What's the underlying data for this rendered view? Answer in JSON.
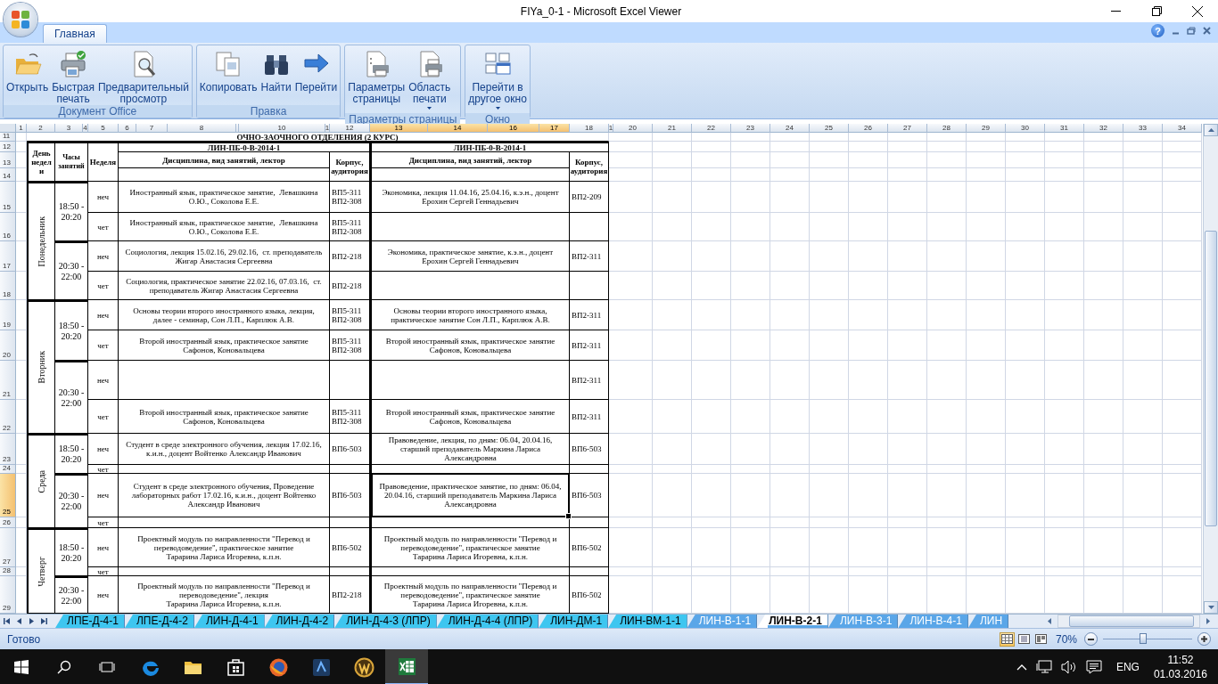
{
  "window": {
    "title": "FIYa_0-1 - Microsoft Excel Viewer"
  },
  "ribbon_tabs": [
    {
      "label": "Главная",
      "selected": true
    }
  ],
  "help": "?",
  "ribbon_groups": [
    {
      "label": "Документ Office",
      "buttons": [
        {
          "label": "Открыть",
          "kind": "open",
          "dropdown": false
        },
        {
          "label": "Быстрая\nпечать",
          "kind": "quick_print",
          "dropdown": false
        },
        {
          "label": "Предварительный\nпросмотр",
          "kind": "preview",
          "dropdown": false
        }
      ]
    },
    {
      "label": "Правка",
      "buttons": [
        {
          "label": "Копировать",
          "kind": "copy",
          "dropdown": false
        },
        {
          "label": "Найти",
          "kind": "find",
          "dropdown": false
        },
        {
          "label": "Перейти",
          "kind": "goto",
          "dropdown": false
        }
      ]
    },
    {
      "label": "Параметры страницы",
      "buttons": [
        {
          "label": "Параметры\nстраницы",
          "kind": "page_setup",
          "dropdown": false
        },
        {
          "label": "Область\nпечати",
          "kind": "print_area",
          "dropdown": true
        }
      ]
    },
    {
      "label": "Окно",
      "buttons": [
        {
          "label": "Перейти в\nдругое окно",
          "kind": "switch_window",
          "dropdown": true
        }
      ]
    }
  ],
  "sheet": {
    "column_headers": [
      {
        "label": "1",
        "selected": false
      },
      {
        "label": "2",
        "selected": false
      },
      {
        "label": "3",
        "selected": false
      },
      {
        "label": "4",
        "selected": false
      },
      {
        "label": "5",
        "selected": false
      },
      {
        "label": "6",
        "selected": false
      },
      {
        "label": "7",
        "selected": false
      },
      {
        "label": "8",
        "selected": false
      },
      {
        "label": "10",
        "selected": false
      },
      {
        "label": "1",
        "selected": false
      },
      {
        "label": "12",
        "selected": false
      },
      {
        "label": "13",
        "selected": true
      },
      {
        "label": "14",
        "selected": true
      },
      {
        "label": "16",
        "selected": true
      },
      {
        "label": "17",
        "selected": true
      },
      {
        "label": "18",
        "selected": false
      },
      {
        "label": "1",
        "selected": false
      },
      {
        "label": "20",
        "selected": false
      },
      {
        "label": "21",
        "selected": false
      },
      {
        "label": "22",
        "selected": false
      },
      {
        "label": "23",
        "selected": false
      },
      {
        "label": "24",
        "selected": false
      },
      {
        "label": "25",
        "selected": false
      },
      {
        "label": "26",
        "selected": false
      },
      {
        "label": "27",
        "selected": false
      },
      {
        "label": "28",
        "selected": false
      },
      {
        "label": "29",
        "selected": false
      },
      {
        "label": "30",
        "selected": false
      },
      {
        "label": "31",
        "selected": false
      },
      {
        "label": "32",
        "selected": false
      },
      {
        "label": "33",
        "selected": false
      },
      {
        "label": "34",
        "selected": false
      }
    ],
    "row_headers": [
      {
        "label": "11",
        "selected": false
      },
      {
        "label": "12",
        "selected": false
      },
      {
        "label": "13",
        "selected": false
      },
      {
        "label": "14",
        "selected": false
      },
      {
        "label": "15",
        "selected": false
      },
      {
        "label": "16",
        "selected": false
      },
      {
        "label": "17",
        "selected": false
      },
      {
        "label": "18",
        "selected": false
      },
      {
        "label": "19",
        "selected": false
      },
      {
        "label": "20",
        "selected": false
      },
      {
        "label": "21",
        "selected": false
      },
      {
        "label": "22",
        "selected": false
      },
      {
        "label": "23",
        "selected": false
      },
      {
        "label": "24",
        "selected": false
      },
      {
        "label": "25",
        "selected": true
      },
      {
        "label": "26",
        "selected": false
      },
      {
        "label": "27",
        "selected": false
      },
      {
        "label": "28",
        "selected": false
      },
      {
        "label": "29",
        "selected": false
      }
    ],
    "title": "ОЧНО-ЗАОЧНОГО ОТДЕЛЕНИЯ (2 КУРС)",
    "header": {
      "day": "День недели",
      "hours": "Часы занятий",
      "week": "Неделя",
      "groups": [
        {
          "name": "ЛИН-ПБ-0-В-2014-1",
          "discipline": "Дисциплина, вид занятий, лектор",
          "room": "Корпус, аудитория"
        },
        {
          "name": "ЛИН-ПБ-0-В-2014-1",
          "discipline": "Дисциплина, вид занятий, лектор",
          "room": "Корпус, аудитория"
        }
      ]
    },
    "days": [
      {
        "day": "Понедельник",
        "slots": [
          {
            "hours": "18:50 -\n20:20",
            "weeks": [
              {
                "week": "неч",
                "lessons": [
                  {
                    "discipline": "Иностранный язык, практическое занятие,  Левашкина\nО.Ю., Соколова Е.Е.",
                    "room": "ВП5-311\nВП2-308",
                    "selected": false
                  },
                  {
                    "discipline": "Экономика, лекция 11.04.16, 25.04.16, к.э.н., доцент\nЕрохин Сергей Геннадьевич",
                    "room": "ВП2-209",
                    "selected": false
                  }
                ]
              },
              {
                "week": "чет",
                "lessons": [
                  {
                    "discipline": "Иностранный язык, практическое занятие,  Левашкина\nО.Ю., Соколова Е.Е.",
                    "room": "ВП5-311\nВП2-308",
                    "selected": false
                  },
                  {
                    "selected": false
                  }
                ]
              }
            ]
          },
          {
            "hours": "20:30 -\n22:00",
            "weeks": [
              {
                "week": "неч",
                "lessons": [
                  {
                    "discipline": "Социология, лекция 15.02.16, 29.02.16,  ст. преподаватель\nЖигар Анастасия Сергеевна",
                    "room": "ВП2-218",
                    "selected": false
                  },
                  {
                    "discipline": "Экономика, практическое занятие, к.э.н., доцент\nЕрохин Сергей Геннадьевич",
                    "room": "ВП2-311",
                    "selected": false
                  }
                ]
              },
              {
                "week": "чет",
                "lessons": [
                  {
                    "discipline": "Социология, практическое занятие 22.02.16, 07.03.16,  ст.\nпреподаватель Жигар Анастасия Сергеевна",
                    "room": "ВП2-218",
                    "selected": false
                  },
                  {
                    "selected": false
                  }
                ]
              }
            ]
          }
        ]
      },
      {
        "day": "Вторник",
        "slots": [
          {
            "hours": "18:50 -\n20:20",
            "weeks": [
              {
                "week": "неч",
                "lessons": [
                  {
                    "discipline": "Основы теории второго иностранного языка, лекция,\nдалее - семинар, Сон Л.П., Карплюк А.В.",
                    "room": "ВП5-311\nВП2-308",
                    "selected": false
                  },
                  {
                    "discipline": "Основы теории второго иностранного языка,\nпрактическое занятие Сон Л.П., Карплюк А.В.",
                    "room": "ВП2-311",
                    "selected": false
                  }
                ]
              },
              {
                "week": "чет",
                "lessons": [
                  {
                    "discipline": "Второй иностранный язык, практическое занятие\nСафонов, Коновальцева",
                    "room": "ВП5-311\nВП2-308",
                    "selected": false
                  },
                  {
                    "discipline": "Второй иностранный язык, практическое занятие\nСафонов, Коновальцева",
                    "room": "ВП2-311",
                    "selected": false
                  }
                ]
              }
            ]
          },
          {
            "hours": "20:30 -\n22:00",
            "weeks": [
              {
                "week": "неч",
                "lessons": [
                  {
                    "selected": false
                  },
                  {
                    "room": "ВП2-311",
                    "selected": false
                  }
                ]
              },
              {
                "week": "чет",
                "lessons": [
                  {
                    "discipline": "Второй иностранный язык, практическое занятие\nСафонов, Коновальцева",
                    "room": "ВП5-311\nВП2-308",
                    "selected": false
                  },
                  {
                    "discipline": "Второй иностранный язык, практическое занятие\nСафонов, Коновальцева",
                    "room": "ВП2-311",
                    "selected": false
                  }
                ]
              }
            ]
          }
        ]
      },
      {
        "day": "Среда",
        "slots": [
          {
            "hours": "18:50 -\n20:20",
            "weeks": [
              {
                "week": "неч",
                "lessons": [
                  {
                    "discipline": "Студент в среде электронного обучения, лекция 17.02.16,\nк.и.н., доцент Войтенко Александр Иванович",
                    "room": "ВП6-503",
                    "selected": false
                  },
                  {
                    "discipline": "Правоведение, лекция, по дням: 06.04, 20.04.16,\nстарший преподаватель Маркина Лариса\nАлександровна",
                    "room": "ВП6-503",
                    "selected": false
                  }
                ]
              },
              {
                "week": "чет",
                "lessons": [
                  {
                    "selected": false
                  },
                  {
                    "selected": false
                  }
                ]
              }
            ]
          },
          {
            "hours": "20:30 -\n22:00",
            "weeks": [
              {
                "week": "неч",
                "lessons": [
                  {
                    "discipline": "Студент в среде электронного обучения, Проведение\nлабораторных работ 17.02.16, к.и.н., доцент Войтенко\nАлександр Иванович",
                    "room": "ВП6-503",
                    "selected": false
                  },
                  {
                    "discipline": "Правоведение, практическое занятие, по дням: 06.04,\n20.04.16, старший преподаватель Маркина Лариса\nАлександровна",
                    "room": "ВП6-503",
                    "selected": true
                  }
                ]
              },
              {
                "week": "чет",
                "lessons": [
                  {
                    "selected": false
                  },
                  {
                    "selected": false
                  }
                ]
              }
            ]
          }
        ]
      },
      {
        "day": "Четверг",
        "slots": [
          {
            "hours": "18:50 -\n20:20",
            "weeks": [
              {
                "week": "неч",
                "lessons": [
                  {
                    "discipline": "Проектный модуль по направленности \"Перевод и\nпереводоведение\", практическое занятие\nТарарина Лариса Игоревна, к.п.н.",
                    "room": "ВП6-502",
                    "selected": false
                  },
                  {
                    "discipline": "Проектный модуль по направленности \"Перевод и\nпереводоведение\", практическое занятие\nТарарина Лариса Игоревна, к.п.н.",
                    "room": "ВП6-502",
                    "selected": false
                  }
                ]
              },
              {
                "week": "чет",
                "lessons": [
                  {
                    "selected": false
                  },
                  {
                    "selected": false
                  }
                ]
              }
            ]
          },
          {
            "hours": "20:30 -\n22:00",
            "weeks": [
              {
                "week": "неч",
                "lessons": [
                  {
                    "discipline": "Проектный модуль по направленности \"Перевод и\nпереводоведение\", лекция\nТарарина Лариса Игоревна, к.п.н.",
                    "room": "ВП2-218",
                    "selected": false
                  },
                  {
                    "discipline": "Проектный модуль по направленности \"Перевод и\nпереводоведение\", практическое занятие\nТарарина Лариса Игоревна, к.п.н.",
                    "room": "ВП6-502",
                    "selected": false
                  }
                ]
              }
            ]
          }
        ]
      }
    ]
  },
  "sheet_tabs": [
    {
      "label": "ЛПЕ-Д-4-1",
      "color": "#3ec6f0",
      "selected": false
    },
    {
      "label": "ЛПЕ-Д-4-2",
      "color": "#3ec6f0",
      "selected": false
    },
    {
      "label": "ЛИН-Д-4-1",
      "color": "#3ec6f0",
      "selected": false
    },
    {
      "label": "ЛИН-Д-4-2",
      "color": "#3ec6f0",
      "selected": false
    },
    {
      "label": "ЛИН-Д-4-3 (ЛПР)",
      "color": "#3ec6f0",
      "selected": false
    },
    {
      "label": "ЛИН-Д-4-4 (ЛПР)",
      "color": "#3ec6f0",
      "selected": false
    },
    {
      "label": "ЛИН-ДМ-1",
      "color": "#3ec6f0",
      "selected": false
    },
    {
      "label": "ЛИН-ВМ-1-1",
      "color": "#3ec6f0",
      "selected": false
    },
    {
      "label": "ЛИН-В-1-1",
      "color": "#5aa6e8",
      "selected": false
    },
    {
      "label": "ЛИН-В-2-1",
      "color": "#5aa6e8",
      "selected": true
    },
    {
      "label": "ЛИН-В-3-1",
      "color": "#5aa6e8",
      "selected": false
    },
    {
      "label": "ЛИН-В-4-1",
      "color": "#5aa6e8",
      "selected": false
    },
    {
      "label": "ЛИН",
      "color": "#5aa6e8",
      "selected": false
    }
  ],
  "status_bar": {
    "status": "Готово",
    "views": [
      {
        "kind": "normal",
        "selected": true
      },
      {
        "kind": "page_layout",
        "selected": false
      },
      {
        "kind": "page_break",
        "selected": false
      }
    ],
    "zoom": "70%",
    "zoom_slider": {
      "level": 0.45
    }
  },
  "taskbar": {
    "apps": [
      {
        "kind": "edge",
        "selected": false
      },
      {
        "kind": "explorer",
        "selected": false
      },
      {
        "kind": "store",
        "selected": false
      },
      {
        "kind": "firefox",
        "selected": false
      },
      {
        "kind": "app",
        "selected": false
      },
      {
        "kind": "game",
        "selected": false
      },
      {
        "kind": "excel",
        "selected": true
      }
    ],
    "language": "ENG",
    "time": "11:52",
    "date": "01.03.2016"
  }
}
